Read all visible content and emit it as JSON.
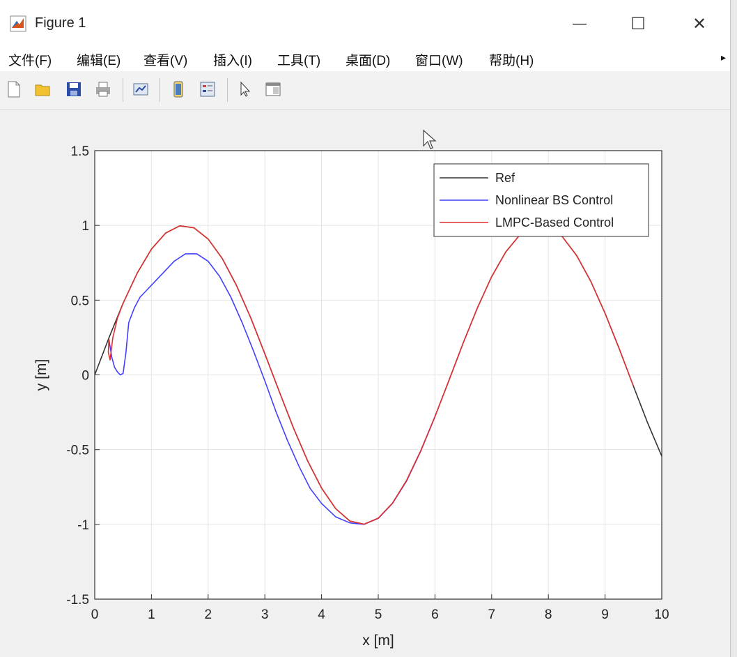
{
  "window": {
    "title": "Figure 1",
    "minimize_glyph": "—",
    "maximize_glyph": "☐",
    "close_glyph": "✕"
  },
  "menu": {
    "items": [
      {
        "label": "文件(F)"
      },
      {
        "label": "编辑(E)"
      },
      {
        "label": "查看(V)"
      },
      {
        "label": "插入(I)"
      },
      {
        "label": "工具(T)"
      },
      {
        "label": "桌面(D)"
      },
      {
        "label": "窗口(W)"
      },
      {
        "label": "帮助(H)"
      }
    ],
    "overflow_glyph": "▸"
  },
  "toolbar": {
    "icons": [
      "new-figure-icon",
      "open-file-icon",
      "save-icon",
      "print-icon",
      "link-plot-icon",
      "colorbar-icon",
      "legend-icon",
      "edit-plot-icon",
      "property-inspector-icon"
    ]
  },
  "chart_data": {
    "type": "line",
    "title": "",
    "xlabel": "x [m]",
    "ylabel": "y [m]",
    "xlim": [
      0,
      10
    ],
    "ylim": [
      -1.5,
      1.5
    ],
    "xticks": [
      "0",
      "1",
      "2",
      "3",
      "4",
      "5",
      "6",
      "7",
      "8",
      "9",
      "10"
    ],
    "yticks": [
      "1.5",
      "1",
      "0.5",
      "0",
      "-0.5",
      "-1",
      "-1.5"
    ],
    "grid": true,
    "legend_position": "top-right",
    "series": [
      {
        "name": "Ref",
        "color": "#333333",
        "x": [
          0,
          0.25,
          0.5,
          0.75,
          1,
          1.25,
          1.5,
          1.75,
          2,
          2.25,
          2.5,
          2.75,
          3,
          3.25,
          3.5,
          3.75,
          4,
          4.25,
          4.5,
          4.75,
          5,
          5.25,
          5.5,
          5.75,
          6,
          6.25,
          6.5,
          6.75,
          7,
          7.25,
          7.5,
          7.75,
          8,
          8.25,
          8.5,
          8.75,
          9,
          9.25,
          9.5,
          9.75,
          10
        ],
        "y": [
          0,
          0.247,
          0.479,
          0.682,
          0.841,
          0.949,
          0.997,
          0.984,
          0.909,
          0.778,
          0.598,
          0.382,
          0.141,
          -0.108,
          -0.351,
          -0.572,
          -0.757,
          -0.895,
          -0.978,
          -0.999,
          -0.959,
          -0.859,
          -0.706,
          -0.508,
          -0.279,
          -0.033,
          0.215,
          0.45,
          0.657,
          0.823,
          0.938,
          0.994,
          0.989,
          0.923,
          0.798,
          0.624,
          0.412,
          0.174,
          -0.075,
          -0.32,
          -0.544
        ]
      },
      {
        "name": "Nonlinear BS Control",
        "color": "#4040ff",
        "x": [
          0.25,
          0.3,
          0.35,
          0.4,
          0.45,
          0.5,
          0.55,
          0.6,
          0.7,
          0.8,
          0.9,
          1,
          1.2,
          1.4,
          1.6,
          1.8,
          2,
          2.2,
          2.4,
          2.6,
          2.8,
          3,
          3.2,
          3.4,
          3.6,
          3.8,
          4,
          4.25,
          4.5,
          4.75,
          5,
          5.25,
          5.5,
          5.75,
          6
        ],
        "y": [
          0.24,
          0.12,
          0.05,
          0.02,
          0.0,
          0.01,
          0.15,
          0.35,
          0.45,
          0.52,
          0.56,
          0.6,
          0.68,
          0.76,
          0.81,
          0.81,
          0.76,
          0.66,
          0.52,
          0.35,
          0.16,
          -0.04,
          -0.25,
          -0.44,
          -0.61,
          -0.76,
          -0.86,
          -0.95,
          -0.99,
          -1.0,
          -0.96,
          -0.86,
          -0.71,
          -0.51,
          -0.28
        ]
      },
      {
        "name": "LMPC-Based Control",
        "color": "#e03030",
        "x": [
          0.25,
          0.24,
          0.27,
          0.32,
          0.4,
          0.5,
          0.75,
          1,
          1.25,
          1.5,
          1.75,
          2,
          2.25,
          2.5,
          2.75,
          3,
          3.25,
          3.5,
          3.75,
          4,
          4.25,
          4.5,
          4.75,
          5,
          5.25,
          5.5,
          5.75,
          6,
          6.25,
          6.5,
          6.75,
          7,
          7.25,
          7.5,
          7.75,
          8,
          8.25,
          8.5,
          8.75,
          9,
          9.25,
          9.5
        ],
        "y": [
          0.24,
          0.15,
          0.1,
          0.25,
          0.38,
          0.479,
          0.682,
          0.841,
          0.949,
          0.997,
          0.984,
          0.909,
          0.778,
          0.598,
          0.382,
          0.141,
          -0.108,
          -0.351,
          -0.572,
          -0.757,
          -0.895,
          -0.978,
          -0.999,
          -0.959,
          -0.859,
          -0.706,
          -0.508,
          -0.279,
          -0.033,
          0.215,
          0.45,
          0.657,
          0.823,
          0.938,
          0.994,
          0.989,
          0.923,
          0.798,
          0.624,
          0.412,
          0.174,
          -0.075
        ]
      }
    ]
  }
}
